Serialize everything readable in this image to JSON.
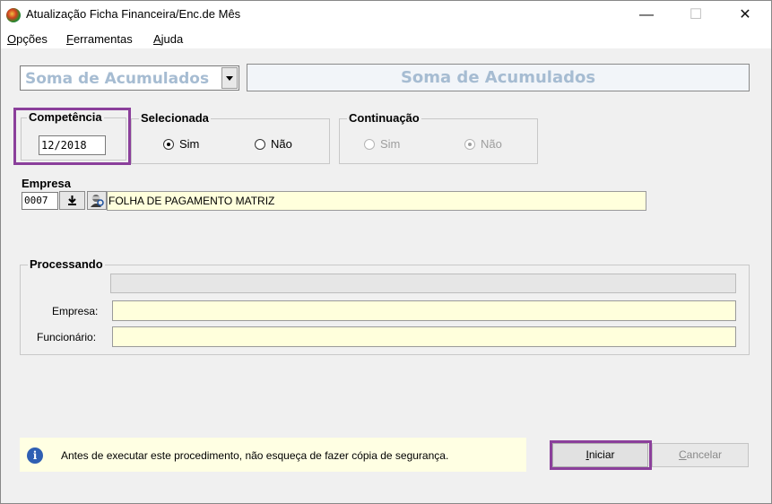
{
  "window": {
    "title": "Atualização Ficha Financeira/Enc.de Mês",
    "minimize": "—",
    "maximize": "☐",
    "close": "✕"
  },
  "menu": {
    "items": [
      {
        "first": "O",
        "rest": "pções"
      },
      {
        "first": "F",
        "rest": "erramentas"
      },
      {
        "first": "A",
        "rest": "juda"
      }
    ]
  },
  "mode": {
    "selected": "Soma de Acumulados",
    "banner": "Soma de Acumulados"
  },
  "competencia": {
    "label": "Competência",
    "value": "12/2018"
  },
  "selecionada": {
    "label": "Selecionada",
    "options": [
      "Sim",
      "Não"
    ],
    "selected": "Sim"
  },
  "continuacao": {
    "label": "Continuação",
    "options": [
      "Sim",
      "Não"
    ],
    "selected": "Não",
    "enabled": false
  },
  "empresa": {
    "label": "Empresa",
    "code": "0007",
    "name": "FOLHA DE PAGAMENTO MATRIZ",
    "lookup_icon": "download-icon",
    "search_icon": "person-search-icon"
  },
  "processando": {
    "label": "Processando",
    "progress": 0,
    "empresa_label": "Empresa:",
    "empresa_value": "",
    "funcionario_label": "Funcionário:",
    "funcionario_value": ""
  },
  "info": {
    "icon": "info-icon",
    "text": "Antes de executar este procedimento, não esqueça de fazer cópia de segurança."
  },
  "buttons": {
    "iniciar": {
      "first": "I",
      "rest": "niciar"
    },
    "cancelar": {
      "first": "C",
      "rest": "ancelar"
    }
  },
  "colors": {
    "highlight": "#8b3f9b",
    "accent_text": "#a6bcd2",
    "field_yellow": "#ffffdc"
  }
}
